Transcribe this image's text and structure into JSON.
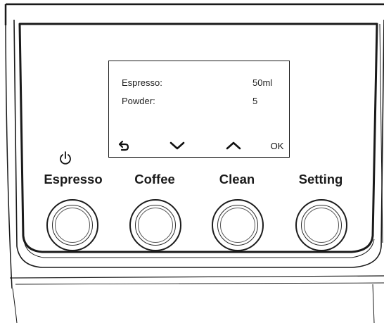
{
  "display": {
    "rows": [
      {
        "label": "Espresso:",
        "value": "50ml"
      },
      {
        "label": "Powder:",
        "value": "5"
      }
    ],
    "softkeys": {
      "back_icon": "back-arrow-icon",
      "down_icon": "chevron-down-icon",
      "up_icon": "chevron-up-icon",
      "ok_label": "OK"
    }
  },
  "buttons": [
    {
      "label": "Espresso",
      "icon": "power-icon"
    },
    {
      "label": "Coffee"
    },
    {
      "label": "Clean"
    },
    {
      "label": "Setting"
    }
  ]
}
